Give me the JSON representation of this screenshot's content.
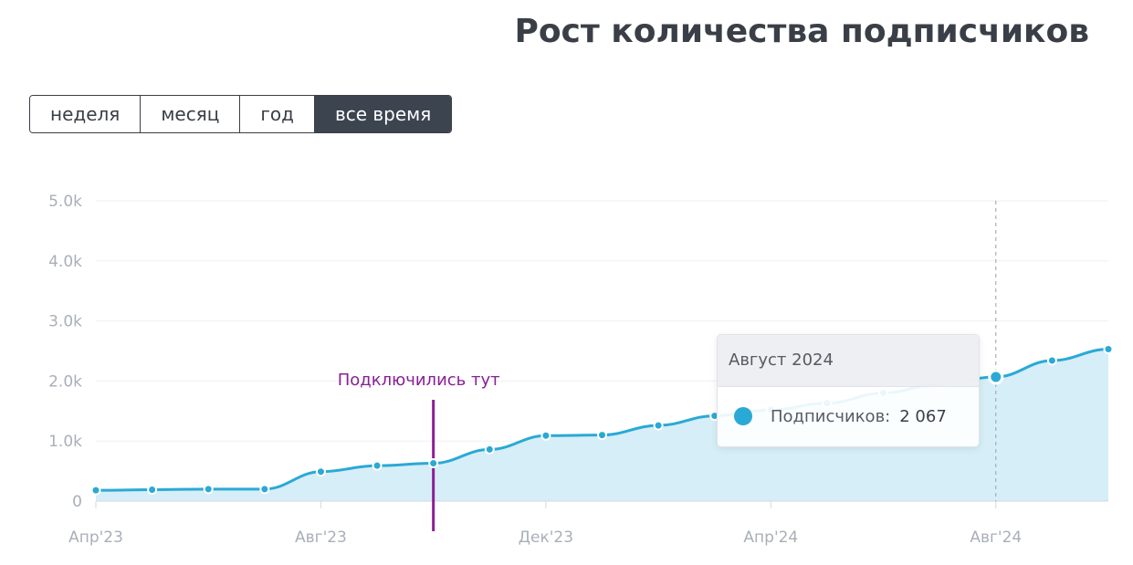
{
  "title": "Рост количества подписчиков",
  "range_buttons": [
    {
      "label": "неделя",
      "active": false
    },
    {
      "label": "месяц",
      "active": false
    },
    {
      "label": "год",
      "active": false
    },
    {
      "label": "все время",
      "active": true
    }
  ],
  "colors": {
    "line": "#2aa9d6",
    "area": "#d6eef7",
    "annotation": "#8a1f96",
    "grid": "#edf0f3",
    "axis": "#d5d9de"
  },
  "tooltip": {
    "header": "Август 2024",
    "series_label": "Подписчиков:",
    "value": "2 067"
  },
  "chart_data": {
    "type": "area",
    "title": "",
    "xlabel": "",
    "ylabel": "",
    "ylim": [
      0,
      5000
    ],
    "y_ticks": [
      0,
      1000,
      2000,
      3000,
      4000,
      5000
    ],
    "y_tick_labels": [
      "0",
      "1.0k",
      "2.0k",
      "3.0k",
      "4.0k",
      "5.0k"
    ],
    "x_ticks": [
      "2023-04",
      "2023-08",
      "2023-12",
      "2024-04",
      "2024-08"
    ],
    "x_tick_labels": [
      "Апр'23",
      "Авг'23",
      "Дек'23",
      "Апр'24",
      "Авг'24"
    ],
    "x_end": "2024-10",
    "grid": true,
    "series": [
      {
        "name": "Подписчиков",
        "x": [
          "2023-04",
          "2023-05",
          "2023-06",
          "2023-07",
          "2023-08",
          "2023-09",
          "2023-10",
          "2023-11",
          "2023-12",
          "2024-01",
          "2024-02",
          "2024-03",
          "2024-04",
          "2024-05",
          "2024-06",
          "2024-07",
          "2024-08",
          "2024-09",
          "2024-10"
        ],
        "values": [
          180,
          190,
          200,
          200,
          490,
          590,
          630,
          860,
          1090,
          1100,
          1260,
          1420,
          1520,
          1630,
          1800,
          1950,
          2067,
          2340,
          2530
        ]
      }
    ],
    "annotations": [
      {
        "label": "Подключились тут",
        "x": "2023-10"
      }
    ],
    "highlight": {
      "x": "2024-08"
    }
  }
}
